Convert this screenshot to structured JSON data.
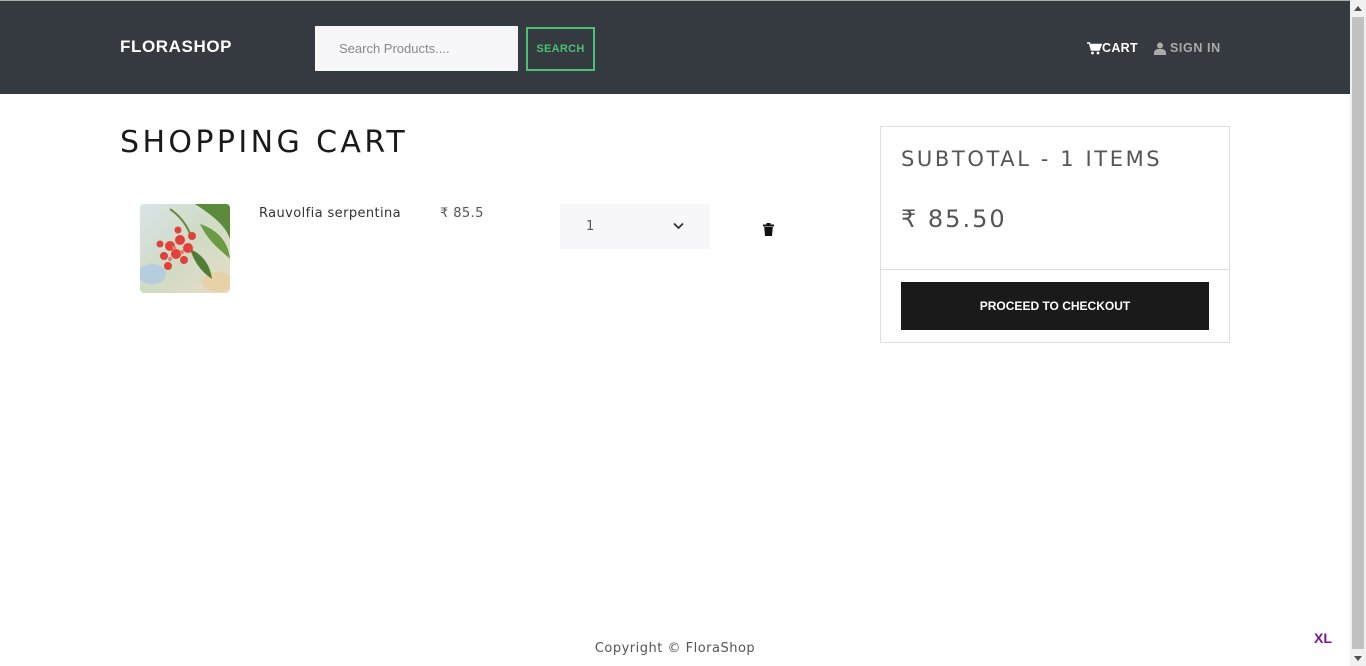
{
  "navbar": {
    "brand": "FLORASHOP",
    "search_placeholder": "Search Products....",
    "search_label": "SEARCH",
    "cart_label": "CART",
    "signin_label": "SIGN IN"
  },
  "cart": {
    "title": "SHOPPING CART",
    "items": [
      {
        "name": "Rauvolfia serpentina",
        "price": "₹ 85.5",
        "quantity": "1"
      }
    ]
  },
  "summary": {
    "title": "SUBTOTAL - 1 ITEMS",
    "total": "₹ 85.50",
    "checkout_label": "PROCEED TO CHECKOUT"
  },
  "footer": {
    "copyright": "Copyright © FloraShop"
  },
  "badge": {
    "label": "XL"
  },
  "colors": {
    "navbar": "#343a40",
    "accent_green": "#4bbf73",
    "checkout": "#1a1a1a"
  },
  "icons": [
    "cart-icon",
    "user-icon",
    "trash-icon",
    "chevron-down-icon"
  ]
}
